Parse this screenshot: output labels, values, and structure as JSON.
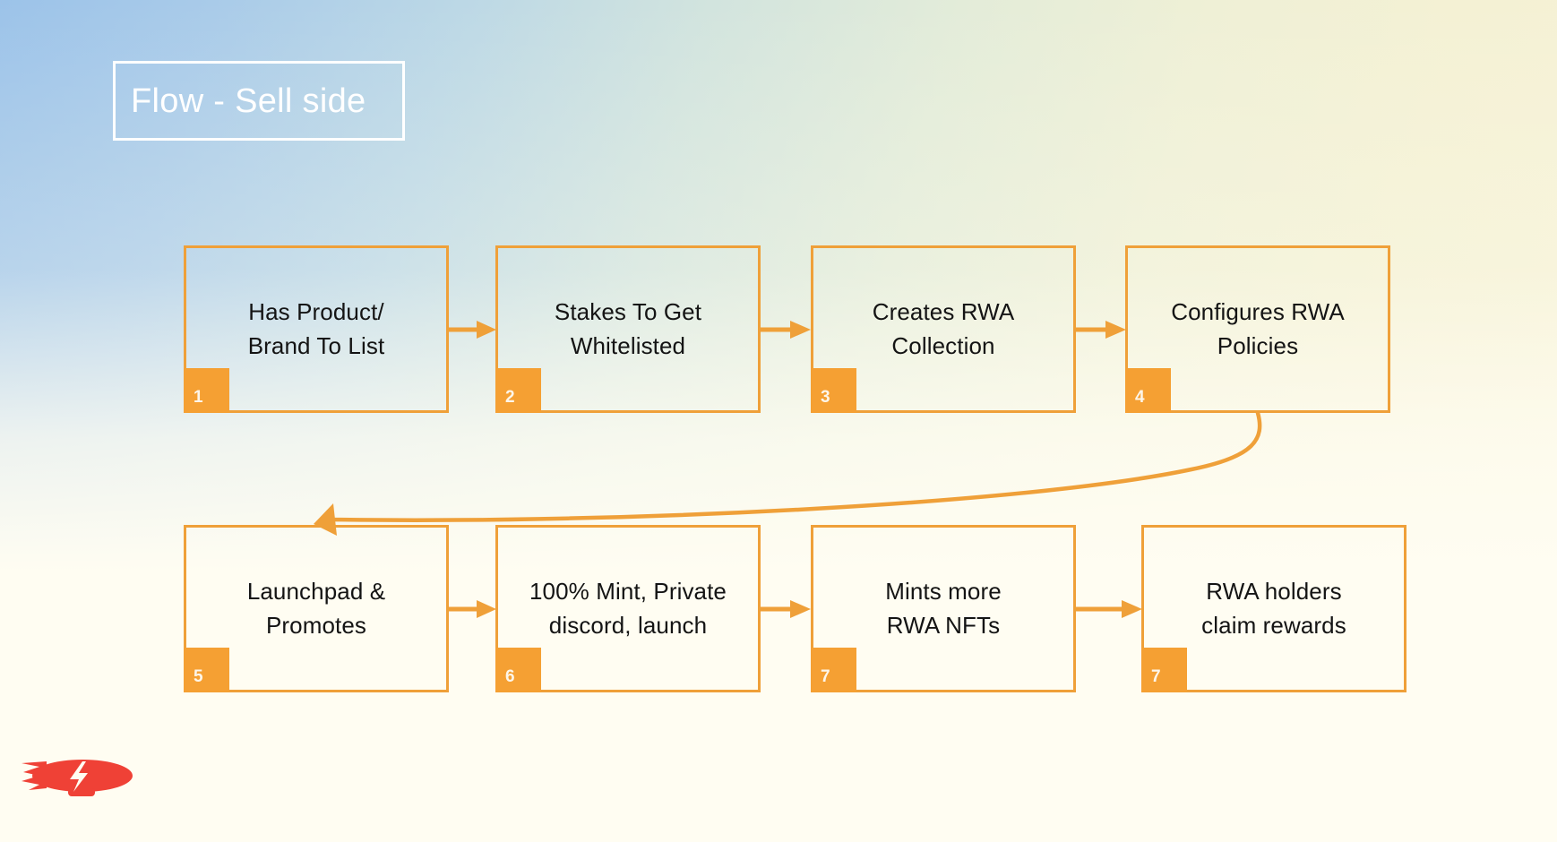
{
  "slide": {
    "title": "Flow - Sell side",
    "background": {
      "top_left_color": "#9cc3e9",
      "top_right_color": "#f4f1d4",
      "bottom_color": "#fffdf2"
    },
    "accent_color": "#efa039",
    "badge_color": "#f5a033",
    "title_border_color": "#ffffff",
    "logo_color": "#ef4136"
  },
  "logo": {
    "name": "blimp-logo",
    "icon": "blimp-with-lightning-bolt",
    "color": "#ef4136",
    "bolt_color": "#fffdf2"
  },
  "flow": {
    "rows": [
      {
        "name": "row-1",
        "nodes": [
          {
            "badge": "1",
            "label": "Has Product/\nBrand To List"
          },
          {
            "badge": "2",
            "label": "Stakes To Get\nWhitelisted"
          },
          {
            "badge": "3",
            "label": "Creates RWA\nCollection"
          },
          {
            "badge": "4",
            "label": "Configures RWA\nPolicies"
          }
        ]
      },
      {
        "name": "row-2",
        "nodes": [
          {
            "badge": "5",
            "label": "Launchpad &\nPromotes"
          },
          {
            "badge": "6",
            "label": "100% Mint, Private\ndiscord, launch"
          },
          {
            "badge": "7",
            "label": "Mints more\nRWA NFTs"
          },
          {
            "badge": "7",
            "label": "RWA holders\nclaim rewards"
          }
        ]
      }
    ],
    "connectors": [
      {
        "name": "arrow-1-to-2",
        "type": "straight-right"
      },
      {
        "name": "arrow-2-to-3",
        "type": "straight-right"
      },
      {
        "name": "arrow-3-to-4",
        "type": "straight-right"
      },
      {
        "name": "arrow-4-to-5",
        "type": "curved-wrap"
      },
      {
        "name": "arrow-5-to-6",
        "type": "straight-right"
      },
      {
        "name": "arrow-6-to-7",
        "type": "straight-right"
      },
      {
        "name": "arrow-7-to-8",
        "type": "straight-right"
      }
    ]
  }
}
